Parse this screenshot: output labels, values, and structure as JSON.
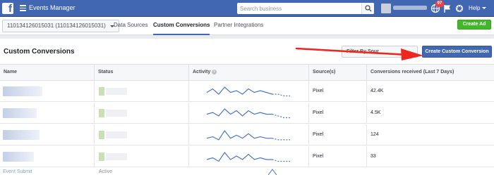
{
  "topbar": {
    "app_title": "Events Manager",
    "search_placeholder": "Search business",
    "notification_count": "97",
    "help_label": "Help"
  },
  "subnav": {
    "account": "110134126015031 (110134126015031)",
    "tabs": [
      {
        "label": "Data Sources",
        "active": false
      },
      {
        "label": "Custom Conversions",
        "active": true
      },
      {
        "label": "Partner Integrations",
        "active": false
      }
    ],
    "create_ad_label": "Create Ad"
  },
  "panel": {
    "title": "Custom Conversions",
    "filter_label": "Filter By Sour",
    "create_button_label": "Create Custom Conversion"
  },
  "table": {
    "columns": [
      "Name",
      "Status",
      "Activity",
      "Source(s)",
      "Conversions received (Last 7 Days)"
    ],
    "rows": [
      {
        "source": "Pixel",
        "conversions": "42.4K",
        "activity": [
          3,
          5,
          2,
          6,
          3,
          4,
          2,
          5,
          3,
          4,
          3,
          2,
          2,
          1,
          1
        ]
      },
      {
        "source": "Pixel",
        "conversions": "4.5K",
        "activity": [
          3,
          4,
          2,
          6,
          3,
          5,
          2,
          5,
          3,
          4,
          3,
          3,
          2,
          1,
          1
        ]
      },
      {
        "source": "Pixel",
        "conversions": "124",
        "activity": [
          2,
          3,
          1,
          7,
          2,
          4,
          2,
          5,
          2,
          3,
          2,
          2,
          1,
          1,
          1
        ]
      },
      {
        "source": "Pixel",
        "conversions": "33",
        "activity": [
          2,
          3,
          1,
          6,
          2,
          4,
          2,
          5,
          2,
          3,
          2,
          2,
          1,
          1,
          1
        ]
      }
    ],
    "partial_row": {
      "name": "Event Submit",
      "status": "Active"
    }
  },
  "colors": {
    "brand_blue": "#4267b2",
    "green": "#42b72a",
    "annotation_red": "#f0251e",
    "spark_line": "#4a76c9"
  }
}
